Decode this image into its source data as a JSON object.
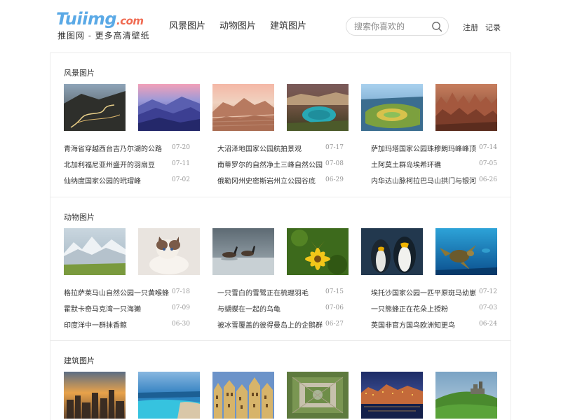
{
  "brand": {
    "logo_main": "Tuiimg",
    "logo_suffix": ".com",
    "tagline": "推图网 - 更多高清壁纸",
    "colors": {
      "logo_blue": "#5aa9e6",
      "logo_red": "#f06b52"
    }
  },
  "nav": {
    "items": [
      {
        "label": "风景图片"
      },
      {
        "label": "动物图片"
      },
      {
        "label": "建筑图片"
      }
    ]
  },
  "search": {
    "placeholder": "搜索你喜欢的",
    "icon": "search-icon"
  },
  "auth": {
    "register": "注册",
    "login": "记录"
  },
  "sections": [
    {
      "title": "风景图片",
      "thumbs": [
        {
          "subject": "winding road through mountains"
        },
        {
          "subject": "blue mountain ridges at dusk"
        },
        {
          "subject": "badlands striped hills"
        },
        {
          "subject": "turquoise crater lake"
        },
        {
          "subject": "aerial island with lagoon"
        },
        {
          "subject": "red eroded canyon"
        }
      ],
      "news": [
        {
          "title": "青海省穿越西台吉乃尔湖的公路",
          "date": "07-20"
        },
        {
          "title": "大沼泽地国家公园航拍景观",
          "date": "07-17"
        },
        {
          "title": "萨加玛塔国家公园珠穆朗玛峰峰顶",
          "date": "07-14"
        },
        {
          "title": "北加利福尼亚州盛开的羽扇豆",
          "date": "07-11"
        },
        {
          "title": "南蒂罗尔的自然净土三峰自然公园",
          "date": "07-08"
        },
        {
          "title": "土阿莫土群岛埃希环礁",
          "date": "07-05"
        },
        {
          "title": "仙纳度国家公园的玳瑁峰",
          "date": "07-02"
        },
        {
          "title": "俄勒冈州史密斯岩州立公园谷底",
          "date": "06-29"
        },
        {
          "title": "内华达山脉柯拉巴马山拱门与银河",
          "date": "06-26"
        }
      ]
    },
    {
      "title": "动物图片",
      "thumbs": [
        {
          "subject": "snowy mountain meadow"
        },
        {
          "subject": "ragdoll cat"
        },
        {
          "subject": "geese on frozen lake"
        },
        {
          "subject": "butterfly on yellow flower"
        },
        {
          "subject": "penguins"
        },
        {
          "subject": "sea turtle underwater"
        }
      ],
      "news": [
        {
          "title": "格拉萨莱马山自然公园一只黄喉蜂虎",
          "date": "07-18"
        },
        {
          "title": "一只雪白的雪鹭正在梳理羽毛",
          "date": "07-15"
        },
        {
          "title": "埃托沙国家公园一匹平原斑马幼崽",
          "date": "07-12"
        },
        {
          "title": "霍默卡奇马克湾一只海獭",
          "date": "07-09"
        },
        {
          "title": "与蝴蝶在一起的乌龟",
          "date": "07-06"
        },
        {
          "title": "一只熊蜂正在花朵上授粉",
          "date": "07-03"
        },
        {
          "title": "印度洋中一群抹香鲸",
          "date": "06-30"
        },
        {
          "title": "被冰雪覆盖的彼得曼岛上的企鹅群",
          "date": "06-27"
        },
        {
          "title": "英国非官方国鸟欧洲知更鸟",
          "date": "06-24"
        }
      ]
    },
    {
      "title": "建筑图片",
      "thumbs": [
        {
          "subject": "city skyline at sunset"
        },
        {
          "subject": "infinity pool by the sea"
        },
        {
          "subject": "ornate guild houses"
        },
        {
          "subject": "aerial palace garden"
        },
        {
          "subject": "harbor village at night"
        },
        {
          "subject": "castle on green hill"
        }
      ],
      "news": []
    }
  ]
}
